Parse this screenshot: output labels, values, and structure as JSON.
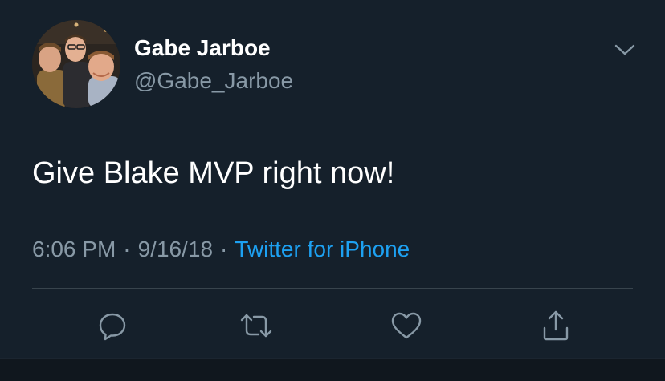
{
  "colors": {
    "background": "#15202b",
    "primary_text": "#ffffff",
    "secondary_text": "#8899a6",
    "link": "#1da1f2",
    "divider": "#38444d"
  },
  "author": {
    "display_name": "Gabe Jarboe",
    "handle": "@Gabe_Jarboe",
    "avatar_icon": "profile-photo"
  },
  "tweet": {
    "text": "Give Blake MVP right now!",
    "time": "6:06 PM",
    "date": "9/16/18",
    "separator": "·",
    "source": "Twitter for iPhone"
  },
  "menu": {
    "icon": "chevron-down-icon"
  },
  "actions": [
    {
      "name": "reply",
      "icon": "reply-icon"
    },
    {
      "name": "retweet",
      "icon": "retweet-icon"
    },
    {
      "name": "like",
      "icon": "heart-icon"
    },
    {
      "name": "share",
      "icon": "share-icon"
    }
  ]
}
